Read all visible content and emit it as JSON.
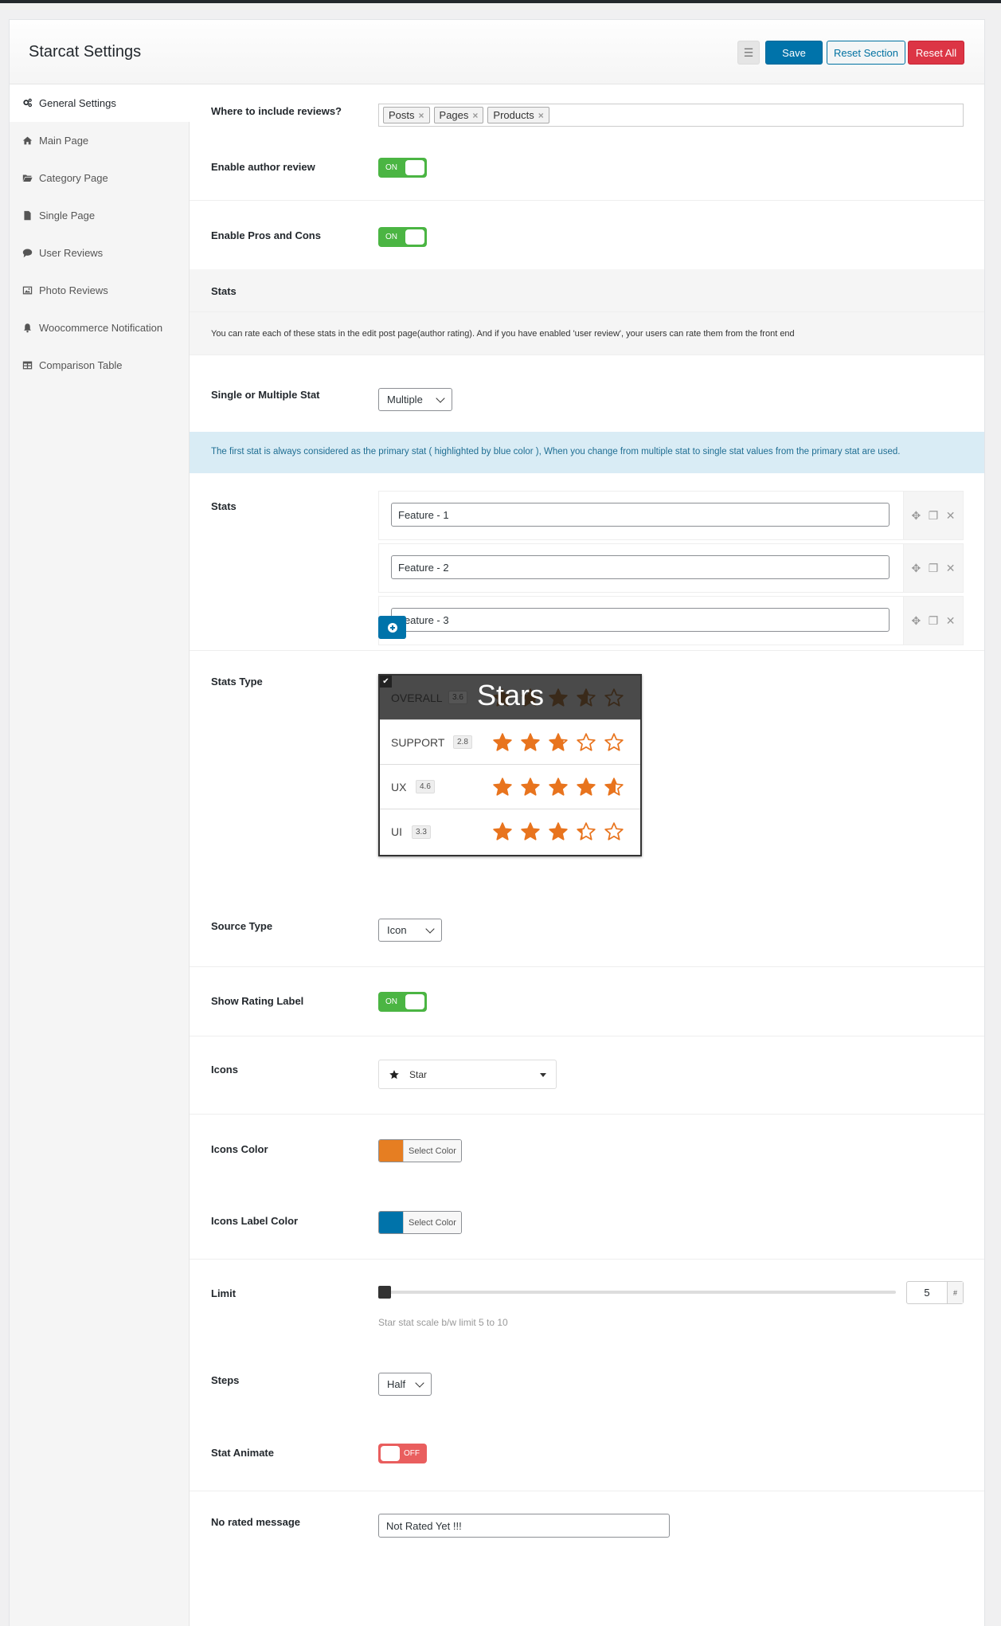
{
  "header": {
    "title": "Starcat Settings",
    "save_label": "Save",
    "reset_section_label": "Reset Section",
    "reset_all_label": "Reset All"
  },
  "sidebar": {
    "items": [
      {
        "label": "General Settings",
        "icon": "gears-icon",
        "active": true
      },
      {
        "label": "Main Page",
        "icon": "home-icon"
      },
      {
        "label": "Category Page",
        "icon": "folder-icon"
      },
      {
        "label": "Single Page",
        "icon": "file-icon"
      },
      {
        "label": "User Reviews",
        "icon": "comment-icon"
      },
      {
        "label": "Photo Reviews",
        "icon": "image-icon"
      },
      {
        "label": "Woocommerce Notification",
        "icon": "bell-icon"
      },
      {
        "label": "Comparison Table",
        "icon": "table-icon"
      }
    ]
  },
  "settings": {
    "include_reviews": {
      "label": "Where to include reviews?",
      "tags": [
        "Posts",
        "Pages",
        "Products"
      ]
    },
    "author_review": {
      "label": "Enable author review",
      "state": "ON"
    },
    "pros_cons": {
      "label": "Enable Pros and Cons",
      "state": "ON"
    },
    "stats_heading": "Stats",
    "stats_desc": "You can rate each of these stats in the edit post page(author rating). And if you have enabled 'user review', your users can rate them from the front end",
    "single_multiple": {
      "label": "Single or Multiple Stat",
      "value": "Multiple"
    },
    "info_notice": "The first stat is always considered as the primary stat ( highlighted by blue color ), When you change from multiple stat to single stat values from the primary stat are used.",
    "stats": {
      "label": "Stats",
      "items": [
        "Feature - 1",
        "Feature - 2",
        "Feature - 3"
      ]
    },
    "stats_type": {
      "label": "Stats Type",
      "option_label": "Stars",
      "preview": [
        {
          "name": "OVERALL",
          "score": "3.6",
          "rating": 3.6
        },
        {
          "name": "SUPPORT",
          "score": "2.8",
          "rating": 2.8
        },
        {
          "name": "UX",
          "score": "4.6",
          "rating": 4.6
        },
        {
          "name": "UI",
          "score": "3.3",
          "rating": 3.3
        }
      ]
    },
    "source_type": {
      "label": "Source Type",
      "value": "Icon"
    },
    "rating_label": {
      "label": "Show Rating Label",
      "state": "ON"
    },
    "icons": {
      "label": "Icons",
      "value": "Star"
    },
    "icons_color": {
      "label": "Icons Color",
      "color": "#e67e22",
      "button": "Select Color"
    },
    "icons_label_color": {
      "label": "Icons Label Color",
      "color": "#0073aa",
      "button": "Select Color"
    },
    "limit": {
      "label": "Limit",
      "value": "5",
      "unit": "#",
      "help": "Star stat scale b/w limit 5 to 10",
      "slider_fraction": 0
    },
    "steps": {
      "label": "Steps",
      "value": "Half"
    },
    "stat_animate": {
      "label": "Stat Animate",
      "state": "OFF"
    },
    "no_rated": {
      "label": "No rated message",
      "value": "Not Rated Yet !!!"
    }
  },
  "colors": {
    "star": "#e8741e",
    "toggle_on": "#4bb543",
    "toggle_off": "#e95e5e",
    "primary": "#0073aa"
  }
}
